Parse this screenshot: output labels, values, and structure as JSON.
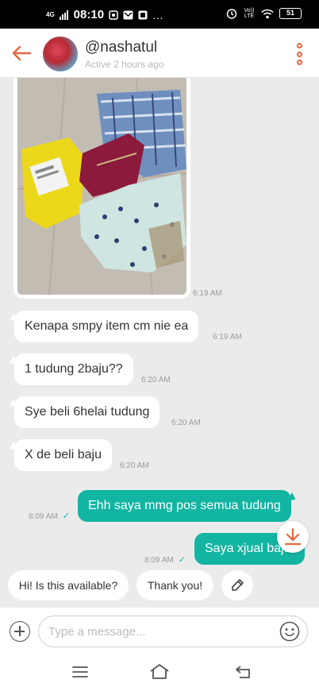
{
  "status_bar": {
    "network": "4G",
    "time": "08:10",
    "dots": "…",
    "volte": "Vo)) LTE",
    "battery": "51"
  },
  "header": {
    "username": "@nashatul",
    "active_status": "Active 2 hours ago"
  },
  "messages": [
    {
      "type": "image",
      "time": "6:19 AM"
    },
    {
      "type": "incoming",
      "text": "Kenapa smpy item cm nie ea",
      "time": "6:19 AM"
    },
    {
      "type": "incoming",
      "text": "1 tudung 2baju??",
      "time": "6:20 AM"
    },
    {
      "type": "incoming",
      "text": "Sye beli 6helai tudung",
      "time": "6:20 AM"
    },
    {
      "type": "incoming",
      "text": "X de beli baju",
      "time": "6:20 AM"
    },
    {
      "type": "outgoing",
      "text": "Ehh saya mmg pos semua tudung",
      "time": "8:09 AM",
      "tick": "✓"
    },
    {
      "type": "outgoing",
      "text": "Saya xjual baju",
      "time": "8:09 AM",
      "tick": "✓"
    }
  ],
  "quick_replies": [
    "Hi! Is this available?",
    "Thank you!"
  ],
  "composer": {
    "placeholder": "Type a message..."
  },
  "icons": {
    "back": "back-arrow-icon",
    "more": "more-vertical-icon",
    "scroll_down": "scroll-down-icon",
    "edit": "edit-icon",
    "add": "add-icon",
    "emoji": "emoji-icon",
    "nav_menu": "menu-icon",
    "nav_home": "home-icon",
    "nav_back": "back-icon"
  },
  "colors": {
    "accent": "#e8663d",
    "outgoing_bubble": "#12b5a2",
    "chat_background": "#ebebeb"
  }
}
